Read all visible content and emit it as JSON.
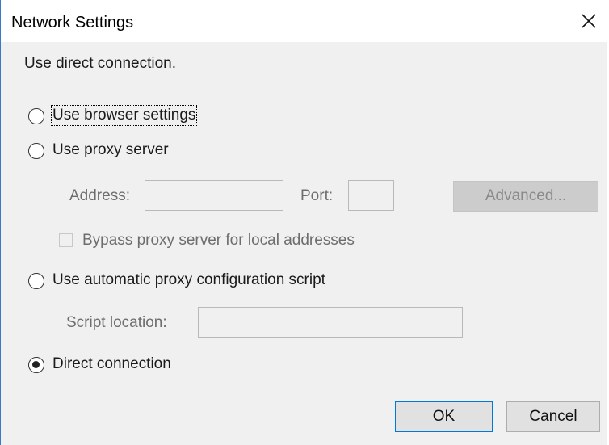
{
  "window": {
    "title": "Network Settings",
    "close_icon": "close-icon"
  },
  "status_text": "Use direct connection.",
  "options": {
    "browser_settings": {
      "label": "Use browser settings",
      "selected": false
    },
    "proxy_server": {
      "label": "Use proxy server",
      "selected": false,
      "address_label": "Address:",
      "address_value": "",
      "port_label": "Port:",
      "port_value": "",
      "advanced_label": "Advanced...",
      "bypass_label": "Bypass proxy server for local addresses",
      "bypass_checked": false
    },
    "auto_config": {
      "label": "Use automatic proxy configuration script",
      "selected": false,
      "script_location_label": "Script location:",
      "script_location_value": ""
    },
    "direct": {
      "label": "Direct connection",
      "selected": true
    }
  },
  "buttons": {
    "ok_label": "OK",
    "cancel_label": "Cancel"
  },
  "colors": {
    "window_border": "#3b78c8",
    "default_button_border": "#0078d7",
    "dialog_background": "#f0f0f0"
  }
}
